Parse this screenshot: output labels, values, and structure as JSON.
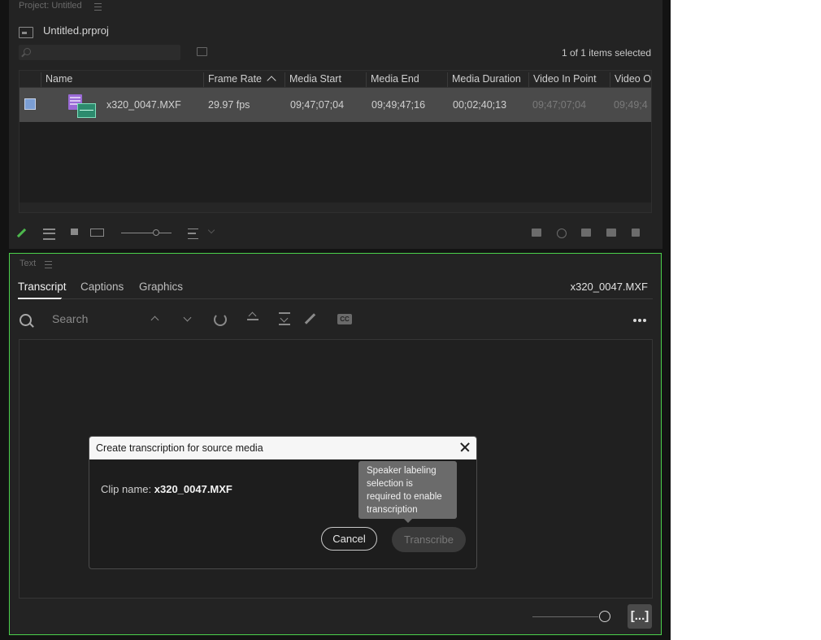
{
  "project": {
    "panel_title": "Project: Untitled",
    "file_name": "Untitled.prproj",
    "selection_status": "1 of 1 items selected",
    "columns": [
      "Name",
      "Frame Rate",
      "Media Start",
      "Media End",
      "Media Duration",
      "Video In Point",
      "Video O"
    ],
    "rows": [
      {
        "name": "x320_0047.MXF",
        "frame_rate": "29.97 fps",
        "media_start": "09;47;07;04",
        "media_end": "09;49;47;16",
        "media_duration": "00;02;40;13",
        "video_in": "09;47;07;04",
        "video_out": "09;49;4"
      }
    ]
  },
  "text_panel": {
    "panel_title": "Text",
    "tabs": [
      "Transcript",
      "Captions",
      "Graphics"
    ],
    "active_tab": "Transcript",
    "clip_name": "x320_0047.MXF",
    "search_placeholder": "Search",
    "bracket_label": "[...]",
    "cc_label": "CC"
  },
  "dialog": {
    "title": "Create transcription for source media",
    "clip_label": "Clip name: ",
    "clip_value": "x320_0047.MXF",
    "cancel_label": "Cancel",
    "transcribe_label": "Transcribe",
    "tooltip": "Speaker labeling selection is required to enable transcription"
  },
  "colors": {
    "panel_focus_border": "#4bd04b",
    "selected_row": "#4a4a4a",
    "video_clip": "#9a6ad6",
    "audio_clip": "#2d8b6e"
  }
}
